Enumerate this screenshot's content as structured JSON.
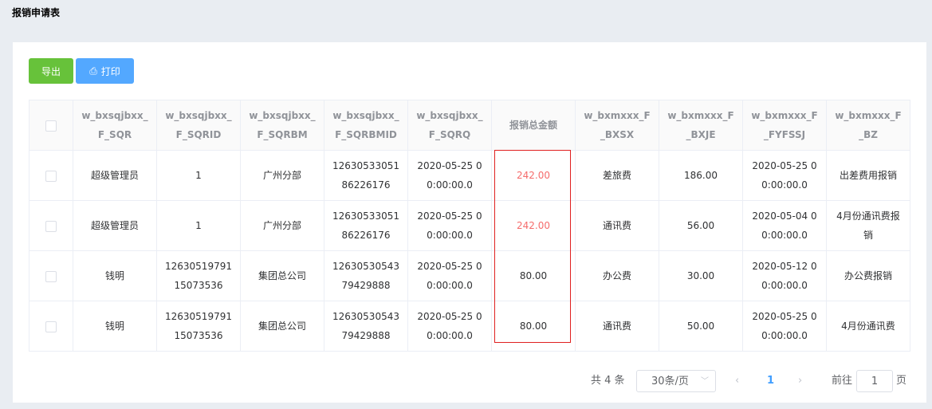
{
  "page": {
    "title": "报销申请表"
  },
  "toolbar": {
    "export_label": "导出",
    "print_label": "打印"
  },
  "table": {
    "headers": [
      "w_bxsqjbxx_F_SQR",
      "w_bxsqjbxx_F_SQRID",
      "w_bxsqjbxx_F_SQRBM",
      "w_bxsqjbxx_F_SQRBMID",
      "w_bxsqjbxx_F_SQRQ",
      "报销总金额",
      "w_bxmxxx_F_BXSX",
      "w_bxmxxx_F_BXJE",
      "w_bxmxxx_F_FYFSSJ",
      "w_bxmxxx_F_BZ"
    ],
    "rows": [
      [
        "超级管理员",
        "1",
        "广州分部",
        "1263053305186226176",
        "2020-05-25 00:00:00.0",
        "242.00",
        "差旅费",
        "186.00",
        "2020-05-25 00:00:00.0",
        "出差费用报销"
      ],
      [
        "超级管理员",
        "1",
        "广州分部",
        "1263053305186226176",
        "2020-05-25 00:00:00.0",
        "242.00",
        "通讯费",
        "56.00",
        "2020-05-04 00:00:00.0",
        "4月份通讯费报销"
      ],
      [
        "钱明",
        "1263051979115073536",
        "集团总公司",
        "1263053054379429888",
        "2020-05-25 00:00:00.0",
        "80.00",
        "办公费",
        "30.00",
        "2020-05-12 00:00:00.0",
        "办公费报销"
      ],
      [
        "钱明",
        "1263051979115073536",
        "集团总公司",
        "1263053054379429888",
        "2020-05-25 00:00:00.0",
        "80.00",
        "通讯费",
        "50.00",
        "2020-05-25 00:00:00.0",
        "4月份通讯费"
      ]
    ]
  },
  "pagination": {
    "total": "共 4 条",
    "page_size": "30条/页",
    "current": "1",
    "goto_label": "前往",
    "goto_value": "1",
    "page_suffix": "页"
  }
}
